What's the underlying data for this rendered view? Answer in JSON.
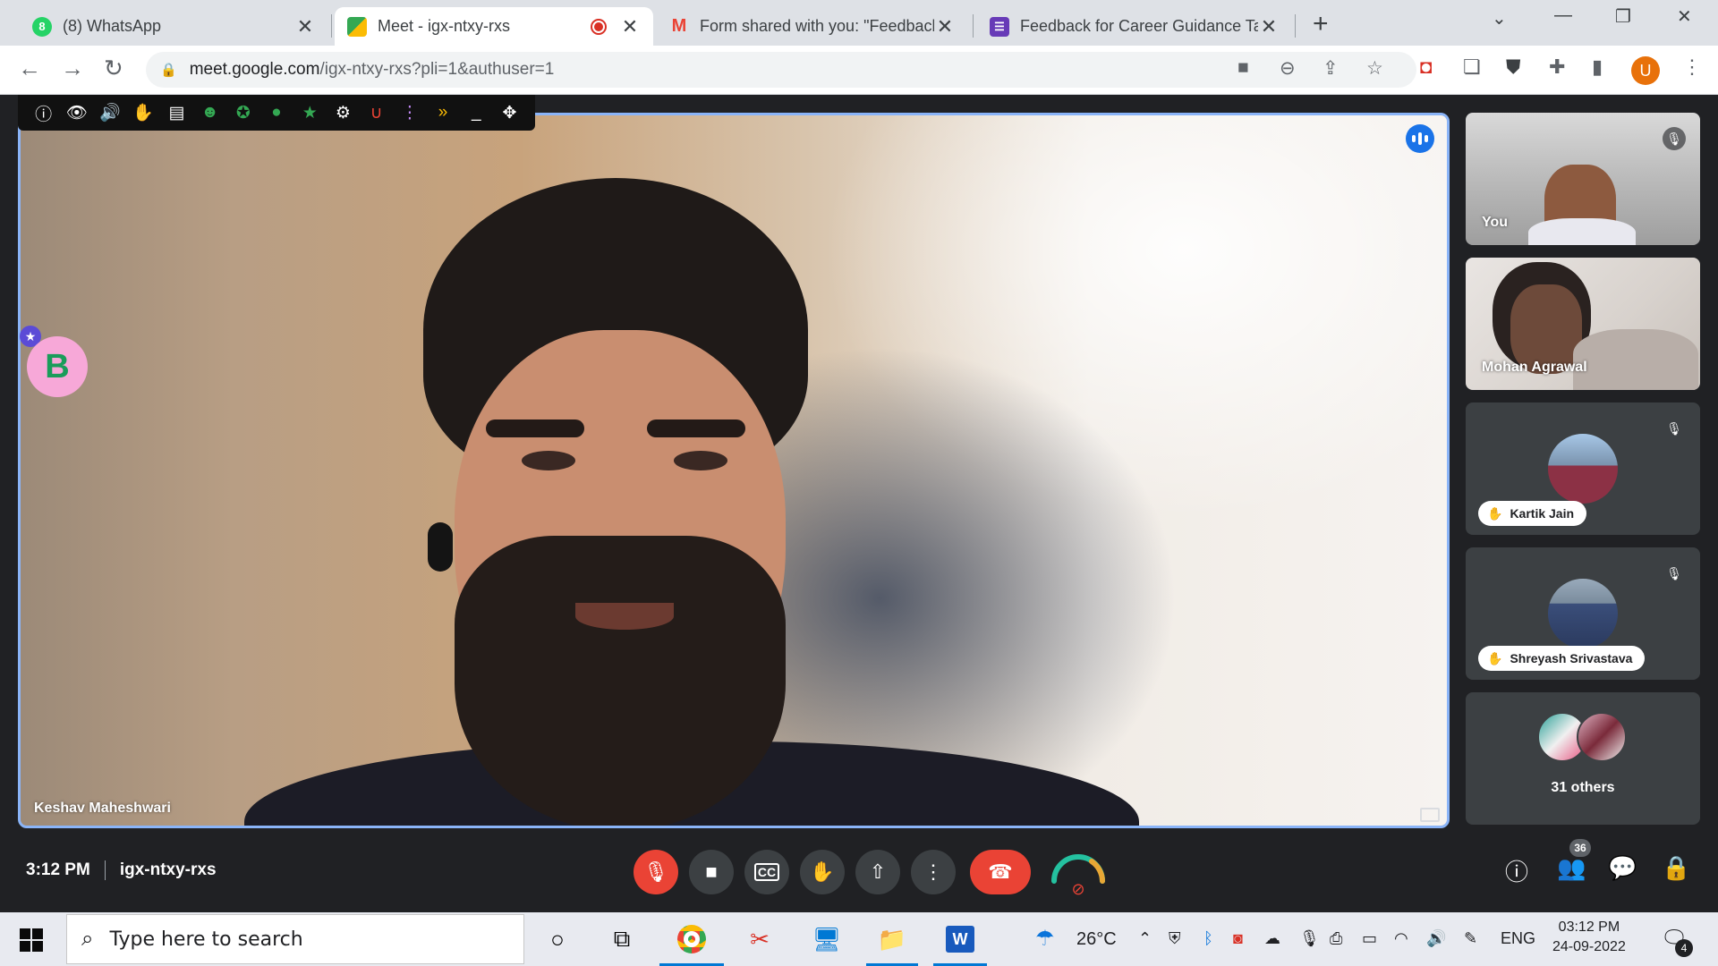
{
  "browser": {
    "tabs": [
      {
        "title": "(8) WhatsApp",
        "icon": "whatsapp-icon",
        "color": "#25d366",
        "glyph": "8",
        "active": false
      },
      {
        "title": "Meet - igx-ntxy-rxs",
        "icon": "google-meet-icon",
        "color": "#00897b",
        "glyph": "",
        "active": true
      },
      {
        "title": "Form shared with you: \"Feedback",
        "icon": "gmail-icon",
        "color": "#ea4335",
        "glyph": "M",
        "active": false
      },
      {
        "title": "Feedback for Career Guidance Ta",
        "icon": "google-forms-icon",
        "color": "#673ab7",
        "glyph": "",
        "active": false
      }
    ],
    "url_host": "meet.google.com",
    "url_path": "/igx-ntxy-rxs?pli=1&authuser=1",
    "profile_initial": "U"
  },
  "meet": {
    "main_speaker": "Keshav Maheshwari",
    "participants": [
      {
        "name": "You",
        "muted": true
      },
      {
        "name": "Mohan Agrawal",
        "muted": false
      },
      {
        "name": "Kartik Jain",
        "muted": true,
        "hand_raised": true
      },
      {
        "name": "Shreyash Srivastava",
        "muted": true,
        "hand_raised": true
      }
    ],
    "others_label": "31 others",
    "time": "3:12 PM",
    "meeting_code": "igx-ntxy-rxs",
    "people_count": "36",
    "floating_badge_letter": "B",
    "accent_blue": "#8ab4f8",
    "hangup_red": "#ea4335"
  },
  "taskbar": {
    "search_placeholder": "Type here to search",
    "weather": "26°C",
    "language": "ENG",
    "clock_time": "03:12 PM",
    "clock_date": "24-09-2022",
    "notification_count": "4"
  }
}
